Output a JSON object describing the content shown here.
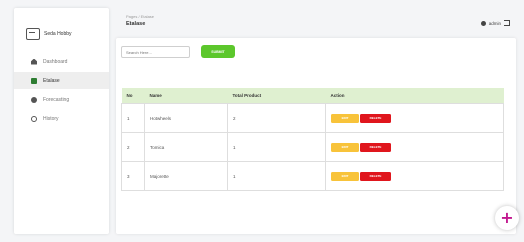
{
  "brand": {
    "name": "Seda Hobby"
  },
  "sidebar": {
    "items": [
      {
        "label": "Dashboard",
        "icon": "home-icon",
        "active": false
      },
      {
        "label": "Etalase",
        "icon": "storefront-icon",
        "active": true
      },
      {
        "label": "Forecasting",
        "icon": "gear-icon",
        "active": false
      },
      {
        "label": "History",
        "icon": "history-icon",
        "active": false
      }
    ]
  },
  "header": {
    "breadcrumb": "Pages / Etalase",
    "title": "Etalase",
    "user": "admin"
  },
  "search": {
    "placeholder": "Search Here...",
    "button": "SUBMIT"
  },
  "table": {
    "columns": [
      "No",
      "Name",
      "Total Product",
      "Action"
    ],
    "rows": [
      {
        "no": "1",
        "name": "Hotwheels",
        "total": "2"
      },
      {
        "no": "2",
        "name": "Tomica",
        "total": "1"
      },
      {
        "no": "3",
        "name": "Majorette",
        "total": "1"
      }
    ],
    "edit_label": "EDIT",
    "delete_label": "DELETE"
  },
  "fab": {
    "label": "+"
  },
  "colors": {
    "accent": "#5cc72c",
    "header_row": "#dff0d0",
    "edit": "#f8c33a",
    "delete": "#e0161d",
    "fab": "#c2188f"
  }
}
